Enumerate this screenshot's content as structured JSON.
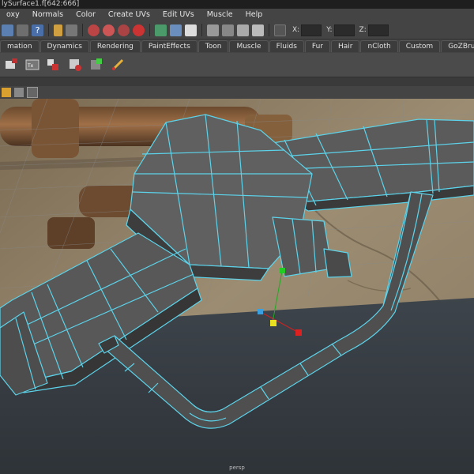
{
  "window": {
    "title": "lySurface1.f[642:666]"
  },
  "menu": {
    "items": [
      "oxy",
      "Normals",
      "Color",
      "Create UVs",
      "Edit UVs",
      "Muscle",
      "Help"
    ]
  },
  "status_line": {
    "x_label": "X:",
    "y_label": "Y:",
    "z_label": "Z:"
  },
  "shelf_tabs": [
    "mation",
    "Dynamics",
    "Rendering",
    "PaintEffects",
    "Toon",
    "Muscle",
    "Fluids",
    "Fur",
    "Hair",
    "nCloth",
    "Custom",
    "GoZBrush"
  ],
  "viewport": {
    "camera_label": "persp"
  },
  "colors": {
    "wire": "#5cd3ea",
    "ui_bg": "#444444",
    "mesh": "#5a5a5a",
    "ground": "#3b4147"
  },
  "icons": {
    "status_line": [
      "select-mode-icon",
      "lasso-icon",
      "help-icon",
      "lock-icon",
      "snap-grid-icon",
      "snap-curve-icon",
      "snap-point-icon",
      "snap-surface-icon",
      "magnet-icon",
      "render-view-icon",
      "history-icon",
      "render-icon",
      "ipr-render-icon",
      "render-settings-icon"
    ],
    "shelf": [
      "poly-tool-icon",
      "text-tool-icon",
      "paint-weights-icon",
      "unfold-icon",
      "uv-snapshot-icon",
      "brush-icon"
    ],
    "panel": [
      "select-camera-icon",
      "camera-attributes-icon",
      "bookmarks-icon"
    ]
  }
}
